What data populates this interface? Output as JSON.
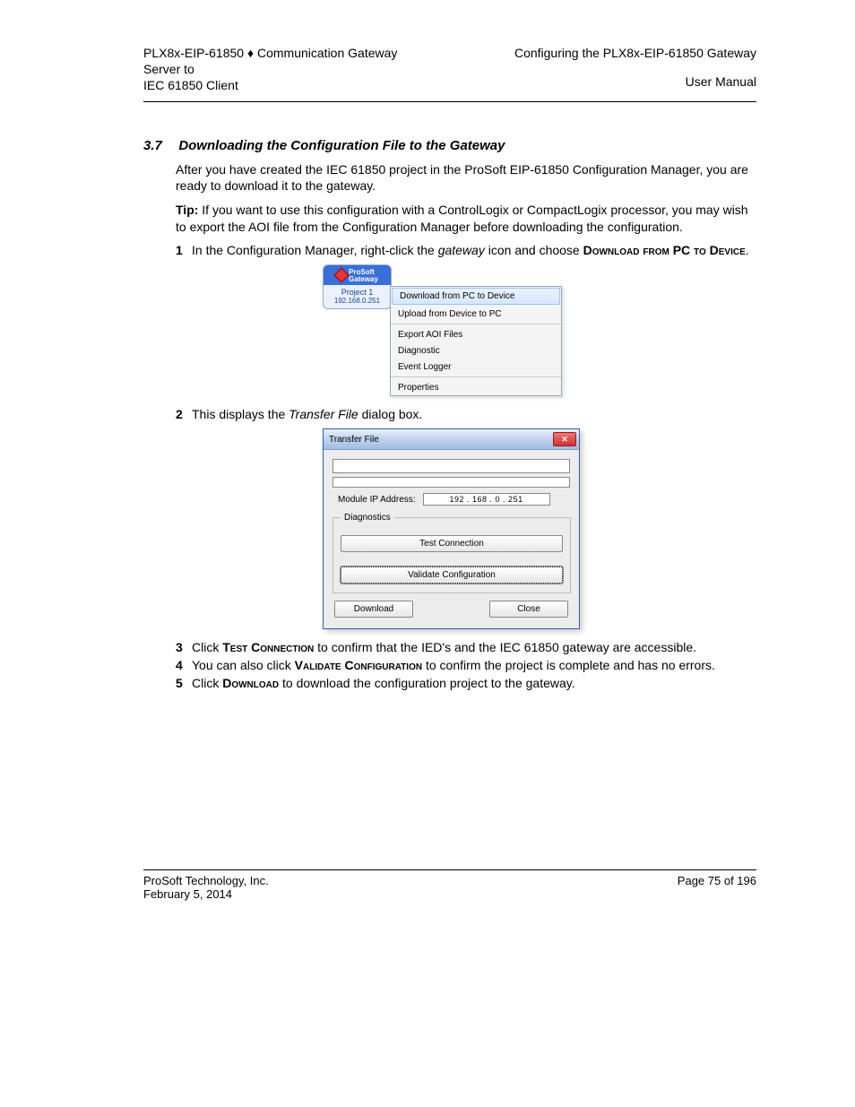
{
  "header": {
    "left1": "PLX8x-EIP-61850 ♦ Communication Gateway",
    "left2": "Server to",
    "left3": "IEC 61850 Client",
    "right1": "Configuring the PLX8x-EIP-61850 Gateway",
    "right2": "User Manual"
  },
  "section": {
    "num": "3.7",
    "title": "Downloading the Configuration File to the Gateway"
  },
  "paragraphs": {
    "intro": "After you have created the IEC 61850 project in the ProSoft EIP-61850 Configuration Manager, you are ready to download it to the gateway.",
    "tip_label": "Tip:",
    "tip_body": " If you want to use this configuration with a ControlLogix or CompactLogix processor, you may wish to export the AOI file from the Configuration Manager before downloading the configuration.",
    "step1_a": "In the Configuration Manager, right-click the ",
    "step1_b": "gateway",
    "step1_c": " icon and choose ",
    "step1_cmd": "Download from PC to Device",
    "step1_d": ".",
    "step2_a": "This displays the ",
    "step2_i": "Transfer File",
    "step2_b": " dialog box.",
    "step3_a": "Click ",
    "step3_btn": "Test Connection",
    "step3_b": " to confirm that the IED's and the IEC 61850 gateway are accessible.",
    "step4_a": "You can also click ",
    "step4_btn": "Validate Configuration",
    "step4_b": " to confirm the project is complete and has no errors.",
    "step5_a": "Click ",
    "step5_btn": "Download",
    "step5_b": " to download the configuration project to the gateway."
  },
  "node_widget": {
    "logo_line1": "ProSoft",
    "logo_line2": "Gateway",
    "project": "Project 1",
    "ip": "192.168.0.251"
  },
  "context_menu": {
    "items": [
      "Download from PC to Device",
      "Upload from Device to PC",
      "Export AOI Files",
      "Diagnostic",
      "Event Logger",
      "Properties"
    ]
  },
  "dialog": {
    "title": "Transfer File",
    "ip_label": "Module IP Address:",
    "ip_value": "192  .  168  .   0   .  251",
    "group_label": "Diagnostics",
    "btn_test": "Test Connection",
    "btn_validate": "Validate Configuration",
    "btn_download": "Download",
    "btn_close": "Close"
  },
  "footer": {
    "left1": "ProSoft Technology, Inc.",
    "left2": "February 5, 2014",
    "right": "Page 75 of 196"
  }
}
